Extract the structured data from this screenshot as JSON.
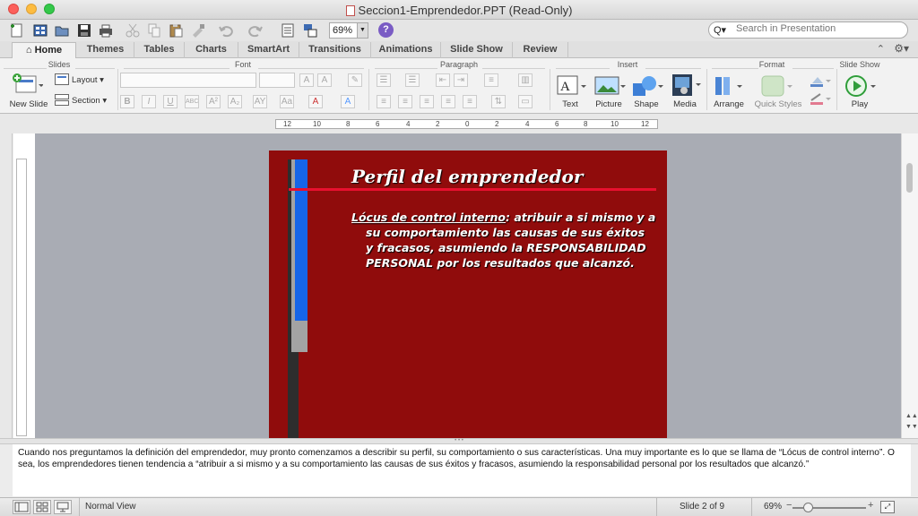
{
  "window": {
    "title": "Seccion1-Emprendedor.PPT (Read-Only)"
  },
  "toolbar": {
    "zoom": "69%",
    "help": "?",
    "search_placeholder": "Search in Presentation",
    "search_icon": "Q▾"
  },
  "ribbon_tabs": [
    {
      "label": "Home"
    },
    {
      "label": "Themes"
    },
    {
      "label": "Tables"
    },
    {
      "label": "Charts"
    },
    {
      "label": "SmartArt"
    },
    {
      "label": "Transitions"
    },
    {
      "label": "Animations"
    },
    {
      "label": "Slide Show"
    },
    {
      "label": "Review"
    }
  ],
  "ribbon": {
    "groups": {
      "slides": "Slides",
      "font": "Font",
      "paragraph": "Paragraph",
      "insert": "Insert",
      "format": "Format",
      "slide_show": "Slide Show"
    },
    "new_slide": "New Slide",
    "layout": "Layout",
    "section": "Section",
    "text": "Text",
    "picture": "Picture",
    "shape": "Shape",
    "media": "Media",
    "arrange": "Arrange",
    "quick_styles": "Quick Styles",
    "play": "Play"
  },
  "ruler": {
    "ticks": [
      "12",
      "10",
      "8",
      "6",
      "4",
      "2",
      "0",
      "2",
      "4",
      "6",
      "8",
      "10",
      "12"
    ]
  },
  "slide": {
    "title": "Perfil del emprendedor",
    "body_term": "Lócus de control interno",
    "body_line1": ": atribuir a si mismo y a",
    "body_line2": "su comportamiento las causas de sus éxitos",
    "body_line3": "y fracasos, asumiendo la RESPONSABILIDAD",
    "body_line4": "PERSONAL por los resultados que alcanzó.",
    "colors": {
      "background": "#900c0c",
      "rule": "#e8102f",
      "accent_bar": "#1665e8"
    }
  },
  "notes": {
    "text": "Cuando nos preguntamos la definición del emprendedor, muy pronto comenzamos a describir su perfil, su comportamiento o sus características. Una muy importante es lo que se llama de “Lócus de control interno”. O sea, los emprendedores tienen tendencia a “atribuir a si mismo y a su comportamiento las causas de sus éxitos y fracasos, asumiendo la responsabilidad personal por los resultados que alcanzó.”"
  },
  "status": {
    "view": "Normal View",
    "slide_count": "Slide 2 of 9",
    "zoom": "69%"
  }
}
